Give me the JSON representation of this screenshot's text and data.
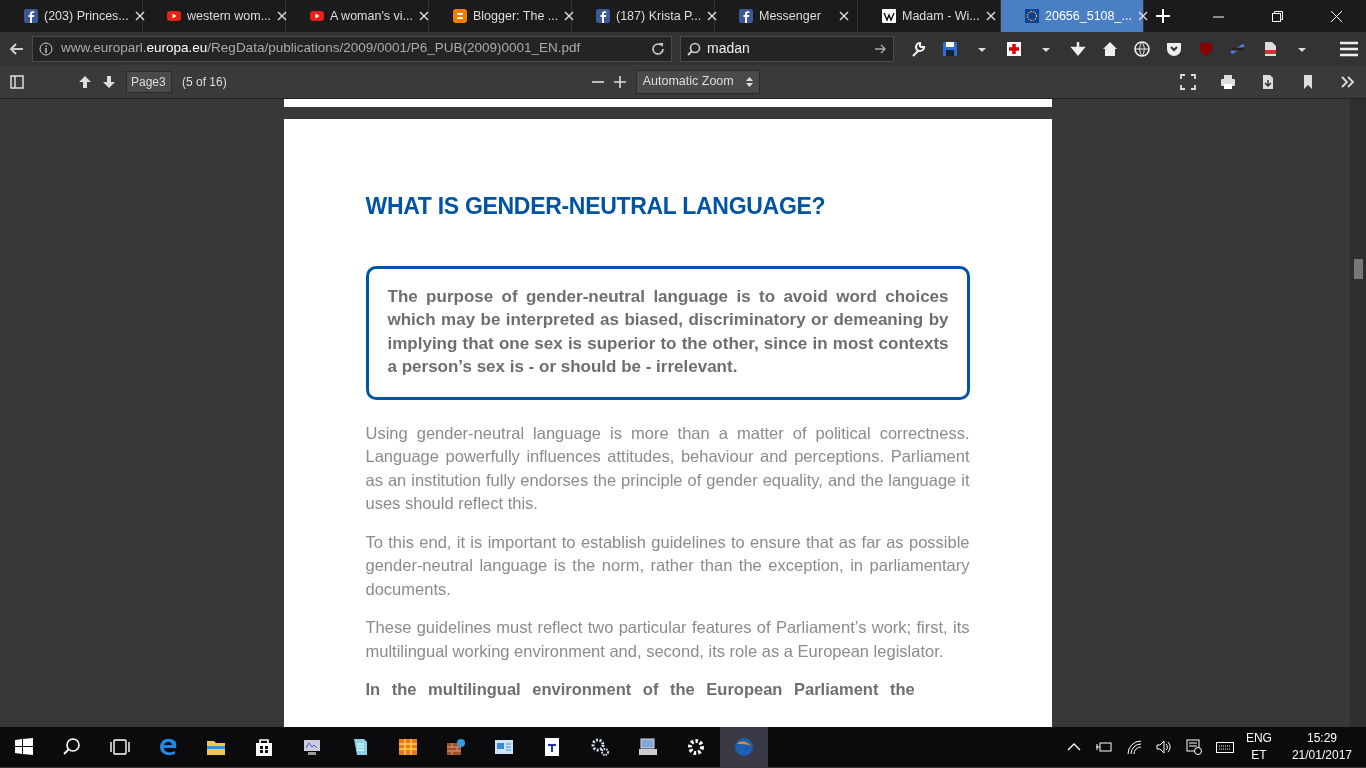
{
  "tabs": [
    {
      "label": "(203) Princes...",
      "kind": "facebook",
      "selected": false
    },
    {
      "label": "western wom...",
      "kind": "youtube",
      "selected": false
    },
    {
      "label": "A woman's vi...",
      "kind": "youtube",
      "selected": false
    },
    {
      "label": "Blogger: The ...",
      "kind": "blogger",
      "selected": false
    },
    {
      "label": "(187) Krista P...",
      "kind": "facebook",
      "selected": false
    },
    {
      "label": "Messenger",
      "kind": "facebook",
      "selected": false
    },
    {
      "label": "Madam - Wi...",
      "kind": "wikipedia",
      "selected": false
    },
    {
      "label": "20656_5108_...",
      "kind": "eu",
      "selected": true
    }
  ],
  "address": {
    "prefix": "www.europarl.",
    "domain": "europa.eu",
    "path": "/RegData/publications/2009/0001/P6_PUB(2009)0001_EN.pdf"
  },
  "search": {
    "value": "madan"
  },
  "pdf_toolbar": {
    "page": "Page3",
    "page_count": "(5 of 16)",
    "zoom": "Automatic Zoom"
  },
  "document": {
    "heading": "WHAT IS GENDER-NEUTRAL LANGUAGE?",
    "callout": "The purpose of gender-neutral language is to avoid word choices which may be interpreted as biased, discriminatory or demeaning by implying that one sex is superior to the other, since in most contexts a person’s sex is - or should be - irrelevant.",
    "paragraphs": [
      {
        "kind": "body",
        "text": "Using gender-neutral language is more than a matter of political correctness. Language powerfully influences attitudes, behaviour and perceptions. Parliament as an institution fully endorses the principle of gender equality, and the language it uses should reflect this."
      },
      {
        "kind": "body",
        "text": "To this end, it is important to establish guidelines to ensure that as far as possible gender-neutral language is the norm, rather than the exception, in parliamentary documents."
      },
      {
        "kind": "body",
        "text": "These guidelines must reflect two particular features of Parliament’s work; first, its multilingual working environment and, second, its role as a European legislator."
      },
      {
        "kind": "emphasis",
        "text": "In the multilingual environment of the European Parliament the"
      }
    ]
  },
  "taskbar": {
    "language": "ENG",
    "layout": "ET",
    "time": "15:29",
    "date": "21/01/2017"
  }
}
